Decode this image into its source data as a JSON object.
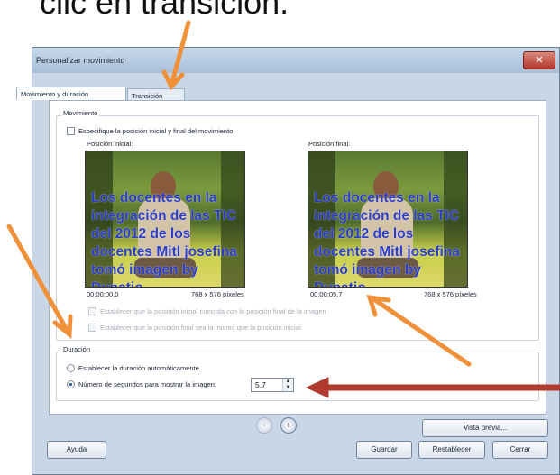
{
  "caption": "clic en transición.",
  "window": {
    "title": "Personalizar movimiento",
    "close_glyph": "✕"
  },
  "tabs": [
    {
      "label": "Movimiento y duración"
    },
    {
      "label": "Transición"
    }
  ],
  "movement": {
    "group_label": "Movimiento",
    "specify_checkbox_label": "Especifique la posición inicial y final del movimiento",
    "start": {
      "label": "Posición inicial:",
      "time": "00:00:00,0",
      "size": "768 x 576 píxeles"
    },
    "end": {
      "label": "Posición final:",
      "time": "00:00:05,7",
      "size": "768 x 576 píxeles"
    },
    "overlay_text": "Los docentes en la integración de las TIC del 2012 de los docentes Mitl josefina tomó imagen by Dupatio",
    "opt1_label": "Establecer que la posición inicial coincida con la posición final de la imagen",
    "opt2_label": "Establecer que la posición final sea la misma que la posición inicial"
  },
  "duration": {
    "group_label": "Duración",
    "auto_label": "Establecer la duración automáticamente",
    "seconds_label": "Número de segundos para mostrar la imagen:",
    "seconds_value": "5,7"
  },
  "nav": {
    "prev_glyph": "‹",
    "next_glyph": "›"
  },
  "buttons": {
    "preview": "Vista previa...",
    "help": "Ayuda",
    "save": "Guardar",
    "reset": "Restablecer",
    "close": "Cerrar"
  },
  "colors": {
    "orange_arrow": "#f0913a",
    "red_arrow": "#b03a2e"
  }
}
